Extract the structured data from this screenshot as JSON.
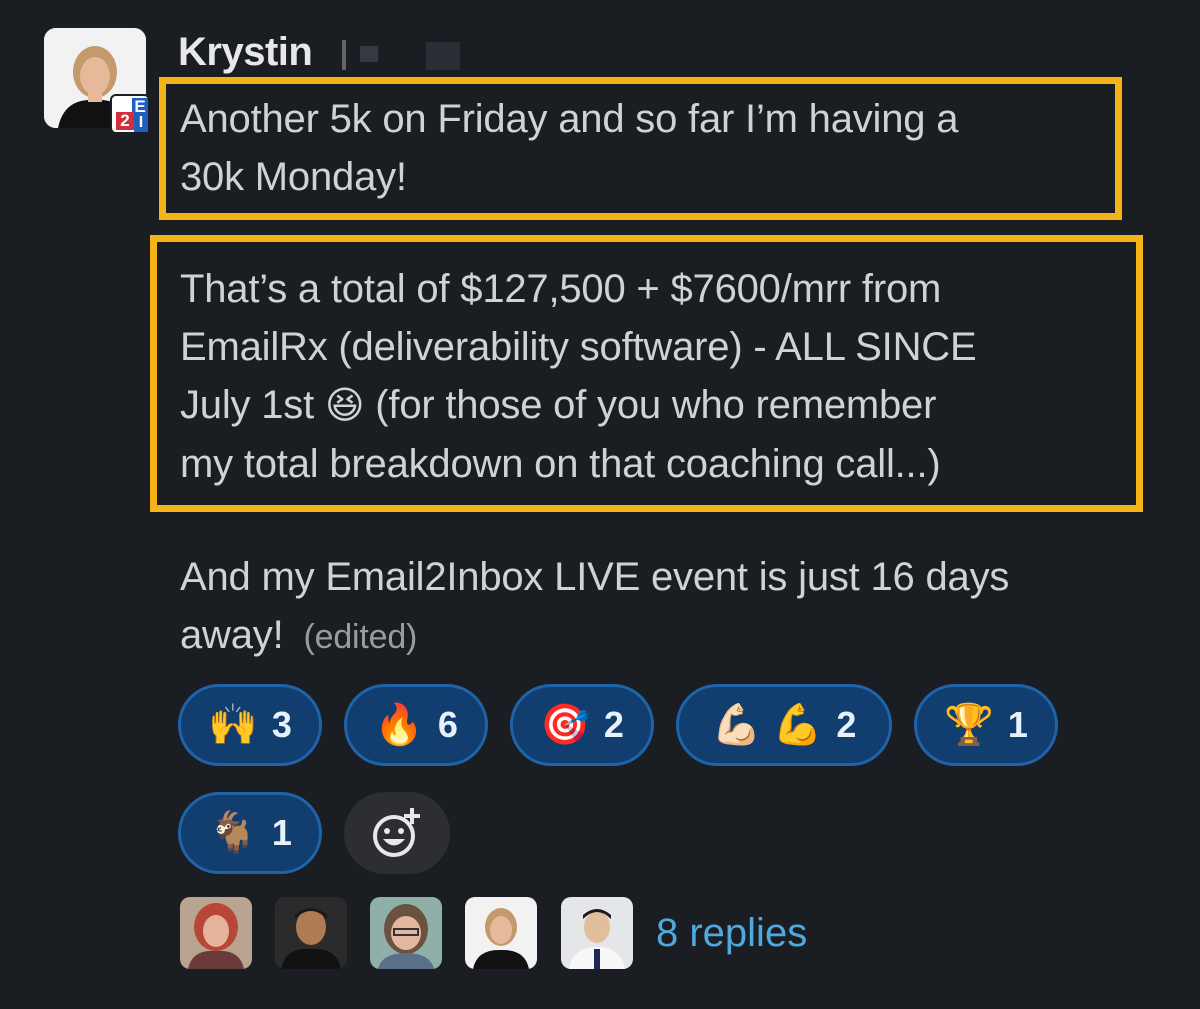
{
  "message": {
    "author": "Krystin",
    "badge_letters": [
      "E",
      "2",
      "I"
    ],
    "paragraph1": "Another 5k on Friday and so far I’m having a\n30k Monday!",
    "paragraph2_line1": "That’s a total of $127,500 + $7600/mrr from",
    "paragraph2_line2": "EmailRx (deliverability software) - ALL SINCE",
    "paragraph2_line3a": "July 1st",
    "paragraph2_emoji": "😆",
    "paragraph2_line3b": "(for those of you who remember",
    "paragraph2_line4": "my total breakdown on that coaching call...)",
    "paragraph3": "And my Email2Inbox LIVE event is just 16 days\naway!",
    "edited_label": "(edited)"
  },
  "reactions": [
    {
      "emoji": "🙌",
      "count": "3"
    },
    {
      "emoji": "🔥",
      "count": "6"
    },
    {
      "emoji": "🎯",
      "count": "2"
    },
    {
      "emoji": "💪🏻 💪",
      "count": "2"
    },
    {
      "emoji": "🏆",
      "count": "1"
    },
    {
      "emoji": "🐐",
      "count": "1"
    }
  ],
  "thread": {
    "replies_label": "8 replies"
  },
  "colors": {
    "background": "#1a1d21",
    "highlight": "#f6b318",
    "reaction_bg": "#113e6e",
    "reaction_border": "#1d64ab",
    "link": "#4fa8e0"
  }
}
